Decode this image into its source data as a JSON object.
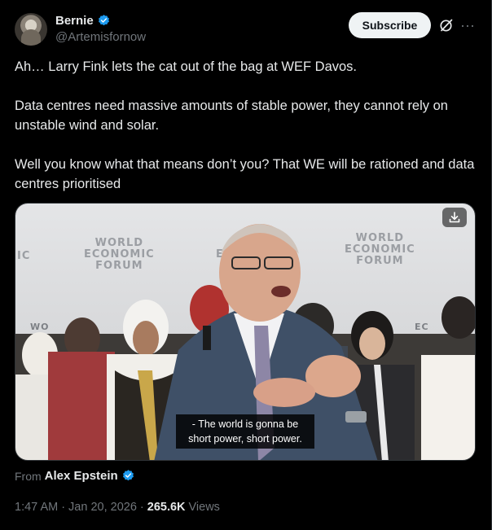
{
  "author": {
    "display_name": "Bernie",
    "handle": "@Artemisfornow",
    "avatar_icon": "profile-photo",
    "verified_icon": "verified-badge-icon"
  },
  "actions": {
    "subscribe_label": "Subscribe",
    "grok_icon": "grok-icon",
    "more_icon": "more-options-icon"
  },
  "tweet": {
    "paragraphs": [
      "Ah… Larry Fink lets the cat out of the bag at WEF Davos.",
      "Data centres need massive amounts of stable power, they cannot rely on unstable wind and solar.",
      "Well you know what that means don’t you? That WE will be rationed and data centres  prioritised"
    ]
  },
  "media": {
    "backdrop_text": [
      "WORLD",
      "ECONOMIC",
      "FORUM"
    ],
    "backdrop_partial_left": "IC",
    "backdrop_partial_mid": "E",
    "backdrop_side_text": [
      "WO",
      "EC"
    ],
    "caption_lines": [
      "- The world is gonna be",
      "short power, short power."
    ],
    "download_icon": "download-icon"
  },
  "source": {
    "prefix": "From",
    "name": "Alex Epstein"
  },
  "meta": {
    "time": "1:47 AM",
    "separator": "·",
    "date": "Jan 20, 2026",
    "views_count": "265.6K",
    "views_label": "Views"
  },
  "colors": {
    "background": "#000000",
    "text": "#e7e9ea",
    "secondary": "#71767b",
    "verified": "#1d9bf0",
    "subscribe_bg": "#eff3f4"
  }
}
